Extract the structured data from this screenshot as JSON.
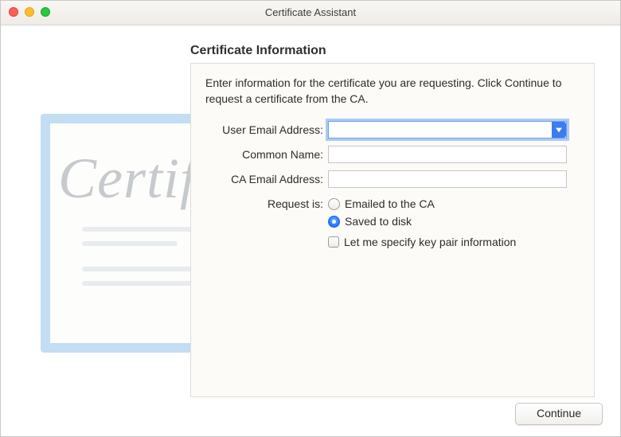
{
  "window": {
    "title": "Certificate Assistant"
  },
  "heading": "Certificate Information",
  "instruction": "Enter information for the certificate you are requesting. Click Continue to request a certificate from the CA.",
  "labels": {
    "user_email": "User Email Address:",
    "common_name": "Common Name:",
    "ca_email": "CA Email Address:",
    "request_is": "Request is:"
  },
  "fields": {
    "user_email_value": "",
    "common_name_value": "",
    "ca_email_value": ""
  },
  "request_options": {
    "emailed": "Emailed to the CA",
    "saved": "Saved to disk",
    "selected": "saved"
  },
  "keypair_option": "Let me specify key pair information",
  "buttons": {
    "continue": "Continue"
  },
  "watermark_text": "Certificate"
}
